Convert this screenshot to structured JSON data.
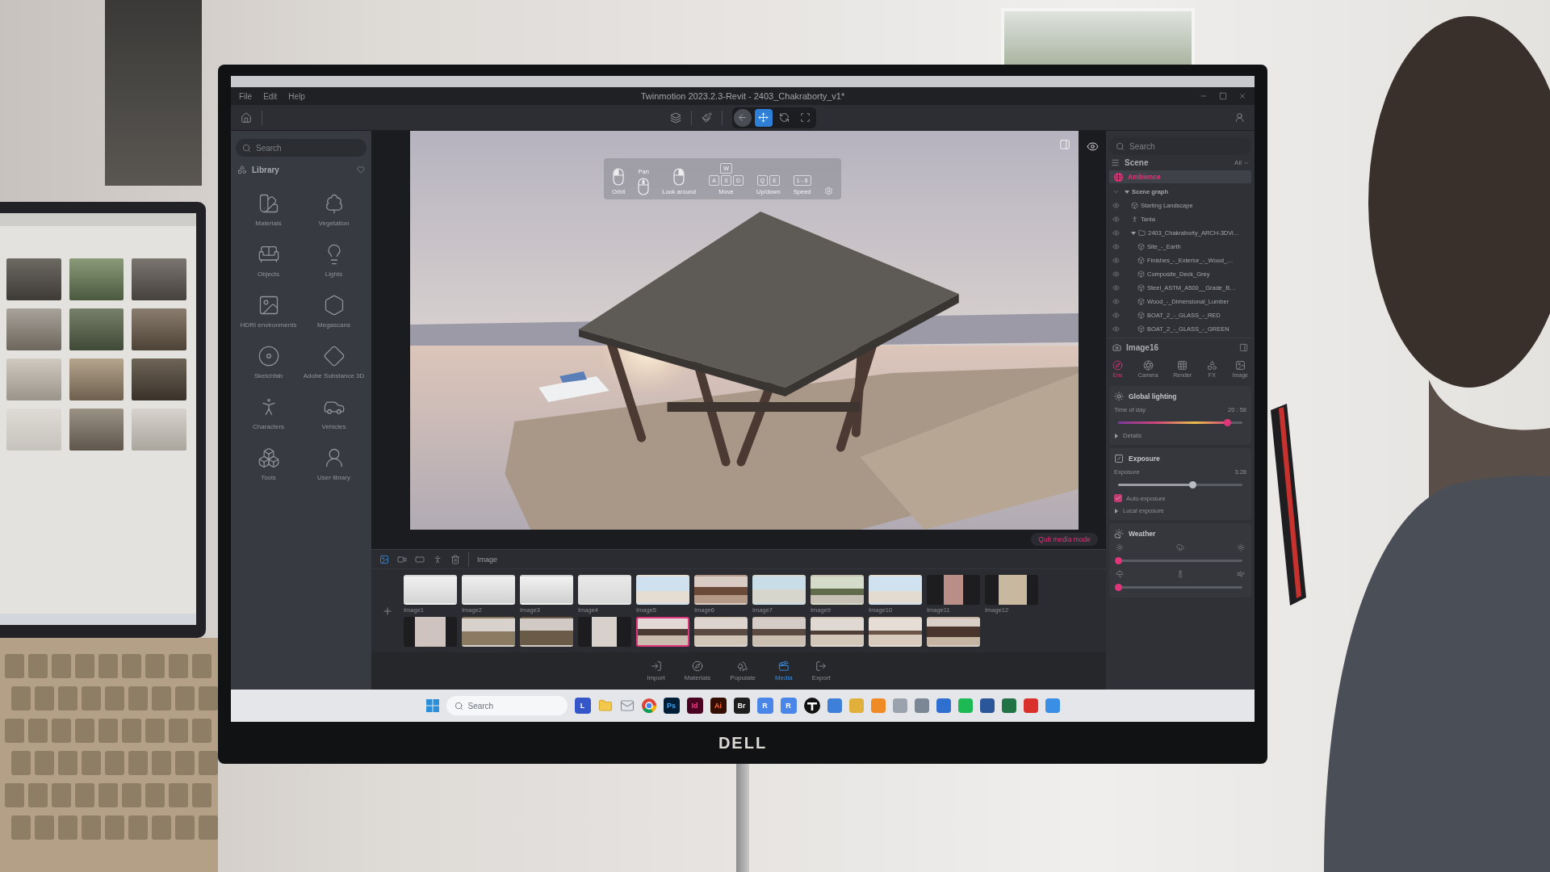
{
  "app": {
    "menu": [
      "File",
      "Edit",
      "Help"
    ],
    "title": "Twinmotion 2023.2.3-Revit - 2403_Chakraborty_v1*",
    "view_modes": [
      {
        "kind": "back",
        "selected": false
      },
      {
        "kind": "move",
        "selected": true
      },
      {
        "kind": "orbit",
        "selected": false
      },
      {
        "kind": "frame",
        "selected": false
      }
    ],
    "library": {
      "search": {
        "placeholder": "Search"
      },
      "title": "Library",
      "items": [
        {
          "kind": "materials",
          "label": "Materials"
        },
        {
          "kind": "vegetation",
          "label": "Vegetation"
        },
        {
          "kind": "objects",
          "label": "Objects"
        },
        {
          "kind": "lights",
          "label": "Lights"
        },
        {
          "kind": "hdri",
          "label": "HDRI environments"
        },
        {
          "kind": "megascans",
          "label": "Megascans"
        },
        {
          "kind": "sketchfab",
          "label": "Sketchfab"
        },
        {
          "kind": "substance",
          "label": "Adobe Substance 3D"
        },
        {
          "kind": "characters",
          "label": "Characters"
        },
        {
          "kind": "vehicles",
          "label": "Vehicles"
        },
        {
          "kind": "tools",
          "label": "Tools"
        },
        {
          "kind": "user",
          "label": "User library"
        }
      ]
    },
    "viewport": {
      "navigation_help": [
        {
          "kind": "leftclick",
          "label": "Orbit"
        },
        {
          "kind": "wheel",
          "label": "Pan"
        },
        {
          "kind": "rightclick",
          "label": "Look around"
        },
        {
          "kind": "keys",
          "keys": [
            [
              "W"
            ],
            [
              "A",
              "S",
              "D"
            ]
          ],
          "label": "Move"
        },
        {
          "kind": "keys",
          "keys": [
            [
              "Q",
              "E"
            ]
          ],
          "label": "Up/down"
        },
        {
          "kind": "keys",
          "keys": [
            [
              "1 - 6"
            ]
          ],
          "label": "Speed"
        }
      ],
      "quit_button": "Quit media mode"
    },
    "scene": {
      "search": {
        "placeholder": "Search"
      },
      "title": "Scene",
      "filter": "All",
      "ambience": {
        "label": "Ambience",
        "selected": true
      },
      "tree": [
        {
          "kind": "group",
          "label": "Scene graph",
          "expanded": true,
          "children": [
            {
              "kind": "object",
              "label": "Starting Landscape"
            },
            {
              "kind": "character",
              "label": "Tania"
            },
            {
              "kind": "folder",
              "label": "2403_Chakraborty_ARCH-3DVi…",
              "expanded": true,
              "children": [
                {
                  "kind": "object",
                  "label": "Site_-_Earth"
                },
                {
                  "kind": "object",
                  "label": "Finishes_-_Exterior_-_Wood_…"
                },
                {
                  "kind": "object",
                  "label": "Composite_Deck_Grey"
                },
                {
                  "kind": "object",
                  "label": "Steel_ASTM_A500__Grade_B…"
                },
                {
                  "kind": "object",
                  "label": "Wood_-_Dimensional_Lumber"
                },
                {
                  "kind": "object",
                  "label": "BOAT_2_-_GLASS_-_RED"
                },
                {
                  "kind": "object",
                  "label": "BOAT_2_-_GLASS_-_GREEN"
                }
              ]
            }
          ]
        }
      ]
    },
    "properties": {
      "title": "Image16",
      "tabs": [
        {
          "kind": "env",
          "label": "Env",
          "selected": true
        },
        {
          "kind": "camera",
          "label": "Camera",
          "selected": false
        },
        {
          "kind": "render",
          "label": "Render",
          "selected": false
        },
        {
          "kind": "fx",
          "label": "FX",
          "selected": false
        },
        {
          "kind": "image",
          "label": "Image",
          "selected": false
        }
      ],
      "sections": [
        {
          "kind": "lighting",
          "title": "Global lighting",
          "slider": {
            "label": "Time of day",
            "reading": "20 : 58",
            "level": 0.88
          },
          "expander": "Details"
        },
        {
          "kind": "exposure",
          "title": "Exposure",
          "slider": {
            "label": "Exposure",
            "reading": "3.28",
            "level": 0.6
          },
          "checkbox": {
            "label": "Auto-exposure",
            "checked": true
          },
          "expander": "Local exposure"
        },
        {
          "kind": "weather",
          "title": "Weather",
          "sliders": [
            {
              "level": 0
            },
            {
              "level": 0
            }
          ]
        }
      ]
    },
    "media": {
      "tabs": [
        {
          "kind": "image",
          "selected": true
        },
        {
          "kind": "video",
          "selected": false
        },
        {
          "kind": "panorama",
          "selected": false
        },
        {
          "kind": "presentation",
          "selected": false
        }
      ],
      "title": "Image",
      "rows": [
        [
          {
            "label": "Image1",
            "selected": false
          },
          {
            "label": "Image2",
            "selected": false
          },
          {
            "label": "Image3",
            "selected": false
          },
          {
            "label": "Image4",
            "selected": false
          },
          {
            "label": "Image5",
            "selected": false
          },
          {
            "label": "Image6",
            "selected": false
          },
          {
            "label": "Image7",
            "selected": false
          },
          {
            "label": "Image9",
            "selected": false
          },
          {
            "label": "Image10",
            "selected": false
          },
          {
            "label": "Image11",
            "selected": false
          },
          {
            "label": "Image12",
            "selected": false
          }
        ],
        [
          {
            "selected": false
          },
          {
            "selected": false
          },
          {
            "selected": false
          },
          {
            "selected": false
          },
          {
            "selected": true
          },
          {
            "selected": false
          },
          {
            "selected": false
          },
          {
            "selected": false
          },
          {
            "selected": false
          },
          {
            "selected": false
          }
        ]
      ]
    },
    "bottom_nav": [
      {
        "kind": "import",
        "label": "Import",
        "selected": false
      },
      {
        "kind": "materials",
        "label": "Materials",
        "selected": false
      },
      {
        "kind": "populate",
        "label": "Populate",
        "selected": false
      },
      {
        "kind": "media",
        "label": "Media",
        "selected": true
      },
      {
        "kind": "export",
        "label": "Export",
        "selected": false
      }
    ]
  },
  "taskbar": {
    "search": {
      "placeholder": "Search"
    },
    "apps": [
      {
        "kind": "letter",
        "label": "L",
        "color": "#3456c8"
      },
      {
        "kind": "folder"
      },
      {
        "kind": "mail"
      },
      {
        "kind": "browser"
      },
      {
        "kind": "letter",
        "label": "Ps",
        "color": "#001e36"
      },
      {
        "kind": "letter",
        "label": "Id",
        "color": "#49021f"
      },
      {
        "kind": "letter",
        "label": "Ai",
        "color": "#330e00"
      },
      {
        "kind": "letter",
        "label": "Br",
        "color": "#1f1e1e"
      },
      {
        "kind": "letter",
        "label": "R",
        "color": "#4a86e8"
      },
      {
        "kind": "letter",
        "label": "R",
        "color": "#4a86e8"
      },
      {
        "kind": "disc"
      },
      {
        "kind": "tile",
        "color": "#3d7fd9"
      },
      {
        "kind": "tile",
        "color": "#e0b03a"
      },
      {
        "kind": "tile",
        "color": "#f08a24"
      },
      {
        "kind": "tile",
        "color": "#9aa3ad"
      },
      {
        "kind": "tile",
        "color": "#7b8794"
      },
      {
        "kind": "tile",
        "color": "#2f6fd0"
      },
      {
        "kind": "tile",
        "color": "#1db954"
      },
      {
        "kind": "tile",
        "color": "#2b579a"
      },
      {
        "kind": "tile",
        "color": "#217346"
      },
      {
        "kind": "tile",
        "color": "#d9302c"
      },
      {
        "kind": "tile",
        "color": "#3a8ee6"
      }
    ]
  },
  "monitor": {
    "brand": "DELL"
  }
}
